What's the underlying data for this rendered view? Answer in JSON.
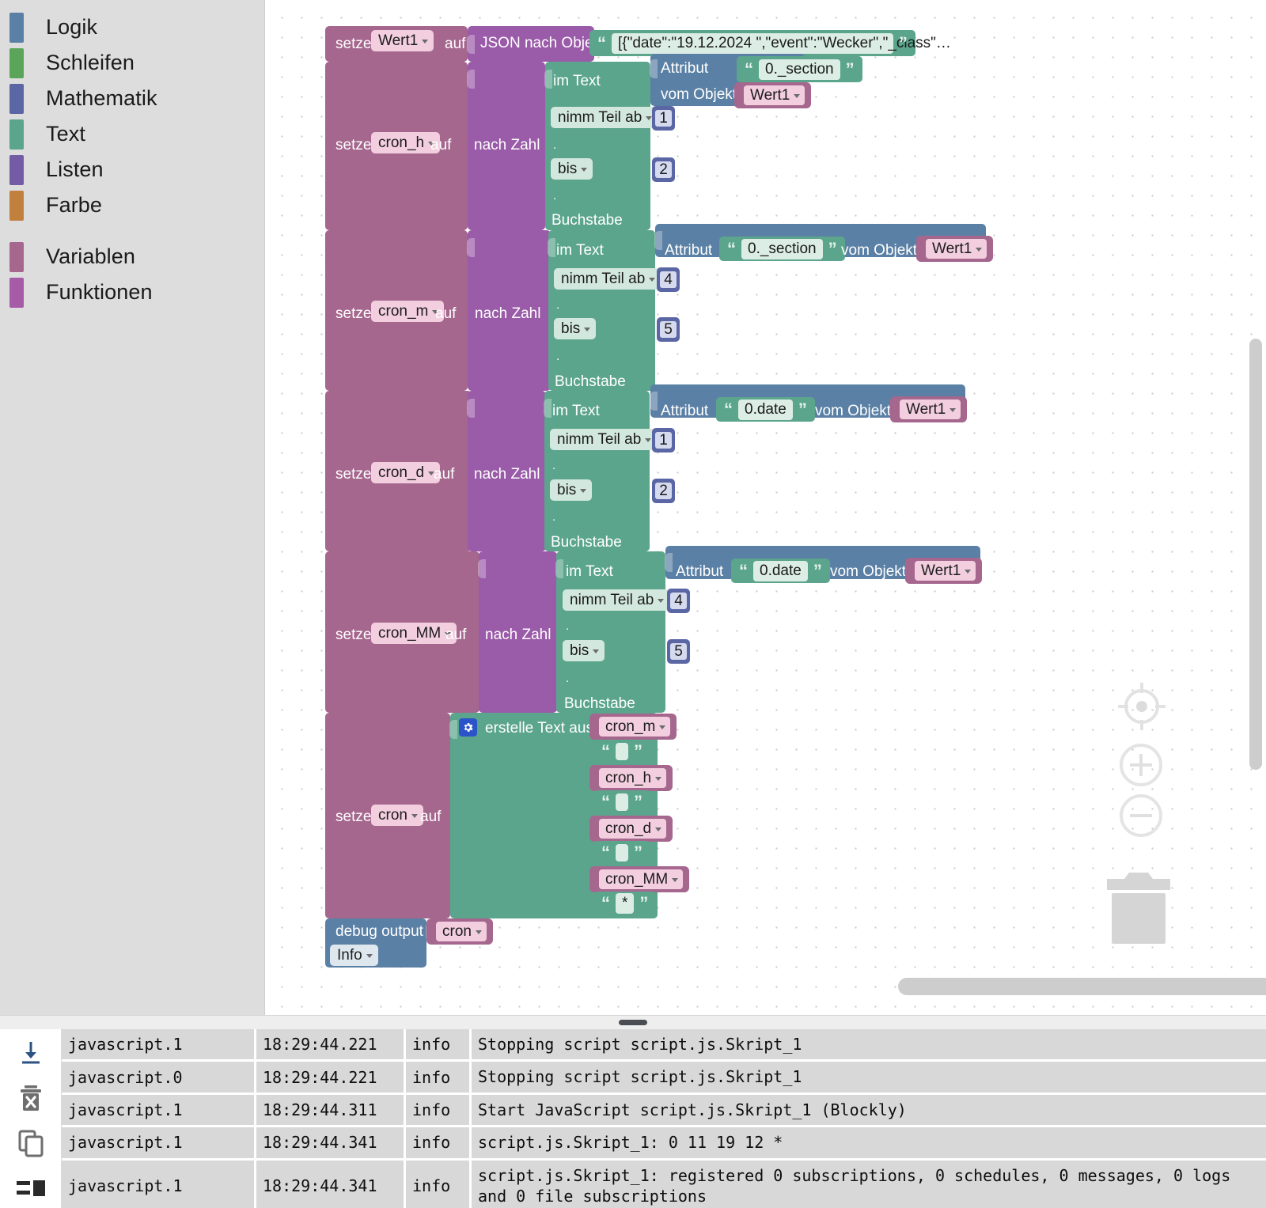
{
  "toolbox": {
    "categories": [
      {
        "label": "Logik",
        "color": "#5B80A5"
      },
      {
        "label": "Schleifen",
        "color": "#5BA55B"
      },
      {
        "label": "Mathematik",
        "color": "#5B67A5"
      },
      {
        "label": "Text",
        "color": "#5BA58C"
      },
      {
        "label": "Listen",
        "color": "#745BA5"
      },
      {
        "label": "Farbe",
        "color": "#C2803F"
      }
    ],
    "categories2": [
      {
        "label": "Variablen",
        "color": "#A5678E"
      },
      {
        "label": "Funktionen",
        "color": "#A55BA5"
      }
    ]
  },
  "workspace": {
    "json_string": "[{\"date\":\"19.12.2024 \",\"event\":\"Wecker\",\"_class\"…",
    "statements": [
      {
        "set_label": "setze",
        "variable": "Wert1",
        "to_label": "auf",
        "value_block": "JSON nach Objekt"
      },
      {
        "set_label": "setze",
        "variable": "cron_h",
        "to_label": "auf",
        "convert_label": "nach Zahl",
        "in_text_label": "im Text",
        "substring_from_label": "nimm Teil ab",
        "from_index": "1",
        "substring_to_label": "bis",
        "to_index": "2",
        "letter_label": "Buchstabe",
        "dot": ".",
        "attribute_label": "Attribut",
        "attribute_value": "0._section",
        "from_object_label": "vom Objekt",
        "object_var": "Wert1"
      },
      {
        "set_label": "setze",
        "variable": "cron_m",
        "to_label": "auf",
        "convert_label": "nach Zahl",
        "in_text_label": "im Text",
        "substring_from_label": "nimm Teil ab",
        "from_index": "4",
        "substring_to_label": "bis",
        "to_index": "5",
        "letter_label": "Buchstabe",
        "dot": ".",
        "attribute_label": "Attribut",
        "attribute_value": "0._section",
        "from_object_label": "vom Objekt",
        "object_var": "Wert1"
      },
      {
        "set_label": "setze",
        "variable": "cron_d",
        "to_label": "auf",
        "convert_label": "nach Zahl",
        "in_text_label": "im Text",
        "substring_from_label": "nimm Teil ab",
        "from_index": "1",
        "substring_to_label": "bis",
        "to_index": "2",
        "letter_label": "Buchstabe",
        "dot": ".",
        "attribute_label": "Attribut",
        "attribute_value": "0.date",
        "from_object_label": "vom Objekt",
        "object_var": "Wert1"
      },
      {
        "set_label": "setze",
        "variable": "cron_MM",
        "to_label": "auf",
        "convert_label": "nach Zahl",
        "in_text_label": "im Text",
        "substring_from_label": "nimm Teil ab",
        "from_index": "4",
        "substring_to_label": "bis",
        "to_index": "5",
        "letter_label": "Buchstabe",
        "dot": ".",
        "attribute_label": "Attribut",
        "attribute_value": "0.date",
        "from_object_label": "vom Objekt",
        "object_var": "Wert1"
      }
    ],
    "create_text": {
      "set_label": "setze",
      "variable": "cron",
      "to_label": "auf",
      "join_label": "erstelle Text aus",
      "items": [
        {
          "type": "variable",
          "value": "cron_m"
        },
        {
          "type": "string",
          "value": " "
        },
        {
          "type": "variable",
          "value": "cron_h"
        },
        {
          "type": "string",
          "value": " "
        },
        {
          "type": "variable",
          "value": "cron_d"
        },
        {
          "type": "string",
          "value": " "
        },
        {
          "type": "variable",
          "value": "cron_MM"
        },
        {
          "type": "string",
          "value": "*"
        }
      ]
    },
    "debug": {
      "label": "debug output",
      "variable": "cron",
      "severity": "Info"
    },
    "controls": {
      "center_icon": "crosshair-target-icon",
      "zoom_in_label": "+",
      "zoom_out_label": "−",
      "trash_icon": "trash-can-icon"
    }
  },
  "log": {
    "tools": [
      {
        "name": "scroll-to-bottom-icon"
      },
      {
        "name": "clear-log-icon"
      },
      {
        "name": "copy-log-icon"
      },
      {
        "name": "log-layout-icon"
      }
    ],
    "rows": [
      {
        "source": "javascript.1",
        "time": "18:29:44.221",
        "severity": "info",
        "message": "Stopping script script.js.Skript_1"
      },
      {
        "source": "javascript.0",
        "time": "18:29:44.221",
        "severity": "info",
        "message": "Stopping script script.js.Skript_1"
      },
      {
        "source": "javascript.1",
        "time": "18:29:44.311",
        "severity": "info",
        "message": "Start JavaScript script.js.Skript_1 (Blockly)"
      },
      {
        "source": "javascript.1",
        "time": "18:29:44.341",
        "severity": "info",
        "message": "script.js.Skript_1: 0 11 19 12 *"
      },
      {
        "source": "javascript.1",
        "time": "18:29:44.341",
        "severity": "info",
        "message": "script.js.Skript_1: registered 0 subscriptions, 0 schedules, 0 messages, 0 logs\nand 0 file subscriptions"
      }
    ]
  }
}
